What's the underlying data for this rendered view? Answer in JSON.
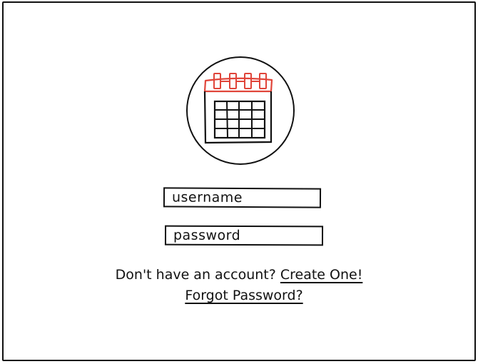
{
  "login": {
    "username_placeholder": "username",
    "password_placeholder": "password"
  },
  "signup": {
    "prompt": "Don't have an account?",
    "create_link": "Create One!"
  },
  "forgot_link": "Forgot Password?",
  "colors": {
    "accent": "#e0453a",
    "ink": "#111111"
  },
  "logo_icon": "calendar-icon"
}
